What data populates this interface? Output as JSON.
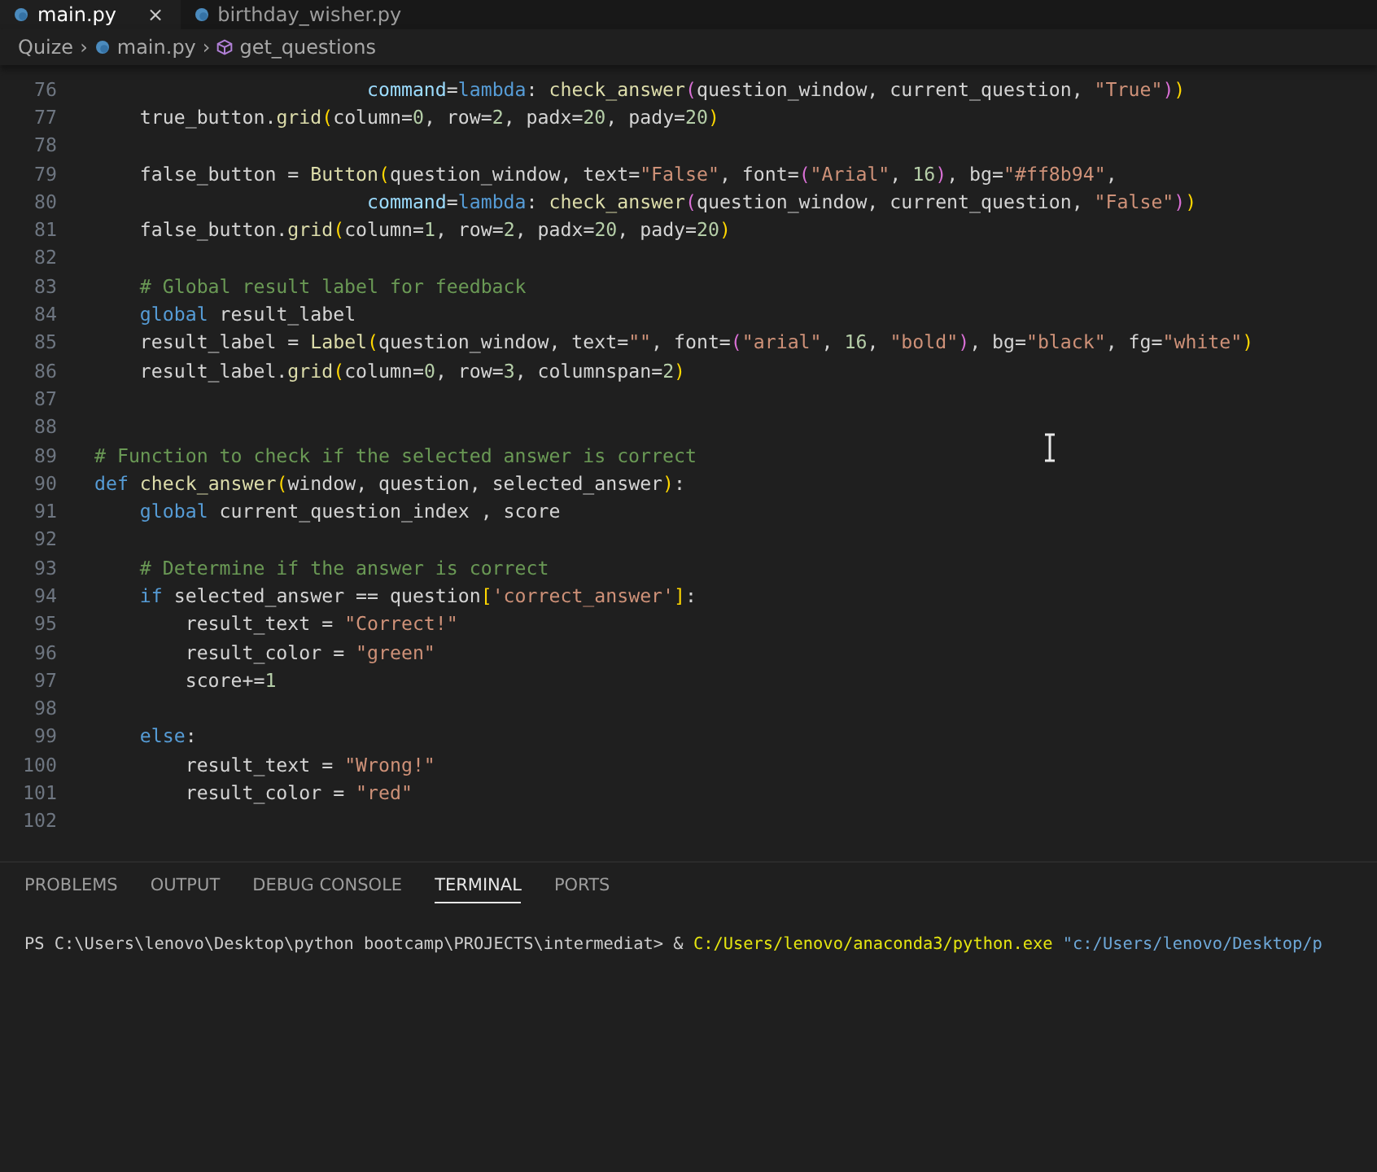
{
  "editor_tabs": [
    {
      "label": "main.py",
      "selected": true,
      "close": "×"
    },
    {
      "label": "birthday_wisher.py",
      "selected": false
    }
  ],
  "breadcrumb": [
    {
      "label": "Quize",
      "kind": "folder"
    },
    {
      "label": "main.py",
      "kind": "file"
    },
    {
      "label": "get_questions",
      "kind": "symbol"
    }
  ],
  "separator": "›",
  "code_lines": [
    {
      "number": "76",
      "tokens": [
        {
          "text": "                        command",
          "kind": "var"
        },
        {
          "text": "=",
          "kind": "plain"
        },
        {
          "text": "lambda",
          "kind": "keyword"
        },
        {
          "text": ": ",
          "kind": "plain"
        },
        {
          "text": "check_answer",
          "kind": "func"
        },
        {
          "text": "(",
          "kind": "bracket2"
        },
        {
          "text": "question_window, current_question, ",
          "kind": "plain"
        },
        {
          "text": "\"True\"",
          "kind": "string"
        },
        {
          "text": ")",
          "kind": "bracket2"
        },
        {
          "text": ")",
          "kind": "bracket"
        }
      ]
    },
    {
      "number": "77",
      "tokens": [
        {
          "text": "    true_button.",
          "kind": "plain"
        },
        {
          "text": "grid",
          "kind": "func"
        },
        {
          "text": "(",
          "kind": "bracket"
        },
        {
          "text": "column=",
          "kind": "plain"
        },
        {
          "text": "0",
          "kind": "number"
        },
        {
          "text": ", row=",
          "kind": "plain"
        },
        {
          "text": "2",
          "kind": "number"
        },
        {
          "text": ", padx=",
          "kind": "plain"
        },
        {
          "text": "20",
          "kind": "number"
        },
        {
          "text": ", pady=",
          "kind": "plain"
        },
        {
          "text": "20",
          "kind": "number"
        },
        {
          "text": ")",
          "kind": "bracket"
        }
      ]
    },
    {
      "number": "78"
    },
    {
      "number": "79",
      "tokens": [
        {
          "text": "    false_button = ",
          "kind": "plain"
        },
        {
          "text": "Button",
          "kind": "func"
        },
        {
          "text": "(",
          "kind": "bracket"
        },
        {
          "text": "question_window, text=",
          "kind": "plain"
        },
        {
          "text": "\"False\"",
          "kind": "string"
        },
        {
          "text": ", font=",
          "kind": "plain"
        },
        {
          "text": "(",
          "kind": "bracket2"
        },
        {
          "text": "\"Arial\"",
          "kind": "string"
        },
        {
          "text": ", ",
          "kind": "plain"
        },
        {
          "text": "16",
          "kind": "number"
        },
        {
          "text": ")",
          "kind": "bracket2"
        },
        {
          "text": ", bg=",
          "kind": "plain"
        },
        {
          "text": "\"#ff8b94\"",
          "kind": "string"
        },
        {
          "text": ",",
          "kind": "plain"
        }
      ]
    },
    {
      "number": "80",
      "tokens": [
        {
          "text": "                        command",
          "kind": "var"
        },
        {
          "text": "=",
          "kind": "plain"
        },
        {
          "text": "lambda",
          "kind": "keyword"
        },
        {
          "text": ": ",
          "kind": "plain"
        },
        {
          "text": "check_answer",
          "kind": "func"
        },
        {
          "text": "(",
          "kind": "bracket2"
        },
        {
          "text": "question_window, current_question, ",
          "kind": "plain"
        },
        {
          "text": "\"False\"",
          "kind": "string"
        },
        {
          "text": ")",
          "kind": "bracket2"
        },
        {
          "text": ")",
          "kind": "bracket"
        }
      ]
    },
    {
      "number": "81",
      "tokens": [
        {
          "text": "    false_button.",
          "kind": "plain"
        },
        {
          "text": "grid",
          "kind": "func"
        },
        {
          "text": "(",
          "kind": "bracket"
        },
        {
          "text": "column=",
          "kind": "plain"
        },
        {
          "text": "1",
          "kind": "number"
        },
        {
          "text": ", row=",
          "kind": "plain"
        },
        {
          "text": "2",
          "kind": "number"
        },
        {
          "text": ", padx=",
          "kind": "plain"
        },
        {
          "text": "20",
          "kind": "number"
        },
        {
          "text": ", pady=",
          "kind": "plain"
        },
        {
          "text": "20",
          "kind": "number"
        },
        {
          "text": ")",
          "kind": "bracket"
        }
      ]
    },
    {
      "number": "82"
    },
    {
      "number": "83",
      "tokens": [
        {
          "text": "    # Global result label for feedback",
          "kind": "comment"
        }
      ]
    },
    {
      "number": "84",
      "tokens": [
        {
          "text": "    global",
          "kind": "keyword"
        },
        {
          "text": " result_label",
          "kind": "plain"
        }
      ]
    },
    {
      "number": "85",
      "tokens": [
        {
          "text": "    result_label = ",
          "kind": "plain"
        },
        {
          "text": "Label",
          "kind": "func"
        },
        {
          "text": "(",
          "kind": "bracket"
        },
        {
          "text": "question_window, text=",
          "kind": "plain"
        },
        {
          "text": "\"\"",
          "kind": "string"
        },
        {
          "text": ", font=",
          "kind": "plain"
        },
        {
          "text": "(",
          "kind": "bracket2"
        },
        {
          "text": "\"arial\"",
          "kind": "string"
        },
        {
          "text": ", ",
          "kind": "plain"
        },
        {
          "text": "16",
          "kind": "number"
        },
        {
          "text": ", ",
          "kind": "plain"
        },
        {
          "text": "\"bold\"",
          "kind": "string"
        },
        {
          "text": ")",
          "kind": "bracket2"
        },
        {
          "text": ", bg=",
          "kind": "plain"
        },
        {
          "text": "\"black\"",
          "kind": "string"
        },
        {
          "text": ", fg=",
          "kind": "plain"
        },
        {
          "text": "\"white\"",
          "kind": "string"
        },
        {
          "text": ")",
          "kind": "bracket"
        }
      ]
    },
    {
      "number": "86",
      "tokens": [
        {
          "text": "    result_label.",
          "kind": "plain"
        },
        {
          "text": "grid",
          "kind": "func"
        },
        {
          "text": "(",
          "kind": "bracket"
        },
        {
          "text": "column=",
          "kind": "plain"
        },
        {
          "text": "0",
          "kind": "number"
        },
        {
          "text": ", row=",
          "kind": "plain"
        },
        {
          "text": "3",
          "kind": "number"
        },
        {
          "text": ", columnspan=",
          "kind": "plain"
        },
        {
          "text": "2",
          "kind": "number"
        },
        {
          "text": ")",
          "kind": "bracket"
        }
      ]
    },
    {
      "number": "87"
    },
    {
      "number": "88"
    },
    {
      "number": "89",
      "tokens": [
        {
          "text": "# Function to check if the selected answer is correct",
          "kind": "comment"
        }
      ]
    },
    {
      "number": "90",
      "tokens": [
        {
          "text": "def",
          "kind": "keyword"
        },
        {
          "text": " check_answer",
          "kind": "func"
        },
        {
          "text": "(",
          "kind": "bracket"
        },
        {
          "text": "window, question, selected_answer",
          "kind": "plain"
        },
        {
          "text": ")",
          "kind": "bracket"
        },
        {
          "text": ":",
          "kind": "plain"
        }
      ]
    },
    {
      "number": "91",
      "tokens": [
        {
          "text": "    global",
          "kind": "keyword"
        },
        {
          "text": " current_question_index , score",
          "kind": "plain"
        }
      ]
    },
    {
      "number": "92"
    },
    {
      "number": "93",
      "tokens": [
        {
          "text": "    # Determine if the answer is correct",
          "kind": "comment"
        }
      ]
    },
    {
      "number": "94",
      "tokens": [
        {
          "text": "    if",
          "kind": "keyword"
        },
        {
          "text": " selected_answer == question",
          "kind": "plain"
        },
        {
          "text": "[",
          "kind": "bracket"
        },
        {
          "text": "'correct_answer'",
          "kind": "string"
        },
        {
          "text": "]",
          "kind": "bracket"
        },
        {
          "text": ":",
          "kind": "plain"
        }
      ]
    },
    {
      "number": "95",
      "tokens": [
        {
          "text": "        result_text = ",
          "kind": "plain"
        },
        {
          "text": "\"Correct!\"",
          "kind": "string"
        }
      ]
    },
    {
      "number": "96",
      "tokens": [
        {
          "text": "        result_color = ",
          "kind": "plain"
        },
        {
          "text": "\"green\"",
          "kind": "string"
        }
      ]
    },
    {
      "number": "97",
      "tokens": [
        {
          "text": "        score+=",
          "kind": "plain"
        },
        {
          "text": "1",
          "kind": "number"
        }
      ]
    },
    {
      "number": "98"
    },
    {
      "number": "99",
      "tokens": [
        {
          "text": "    else",
          "kind": "keyword"
        },
        {
          "text": ":",
          "kind": "plain"
        }
      ]
    },
    {
      "number": "100",
      "tokens": [
        {
          "text": "        result_text = ",
          "kind": "plain"
        },
        {
          "text": "\"Wrong!\"",
          "kind": "string"
        }
      ]
    },
    {
      "number": "101",
      "tokens": [
        {
          "text": "        result_color = ",
          "kind": "plain"
        },
        {
          "text": "\"red\"",
          "kind": "string"
        }
      ]
    },
    {
      "number": "102"
    }
  ],
  "panel_tabs": [
    {
      "label": "PROBLEMS",
      "selected": false
    },
    {
      "label": "OUTPUT",
      "selected": false
    },
    {
      "label": "DEBUG CONSOLE",
      "selected": false
    },
    {
      "label": "TERMINAL",
      "selected": true
    },
    {
      "label": "PORTS",
      "selected": false
    }
  ],
  "terminal": {
    "prompt": "PS C:\\Users\\lenovo\\Desktop\\python bootcamp\\PROJECTS\\intermediat> &",
    "command": "C:/Users/lenovo/anaconda3/python.exe",
    "argument": "\"c:/Users/lenovo/Desktop/p"
  }
}
